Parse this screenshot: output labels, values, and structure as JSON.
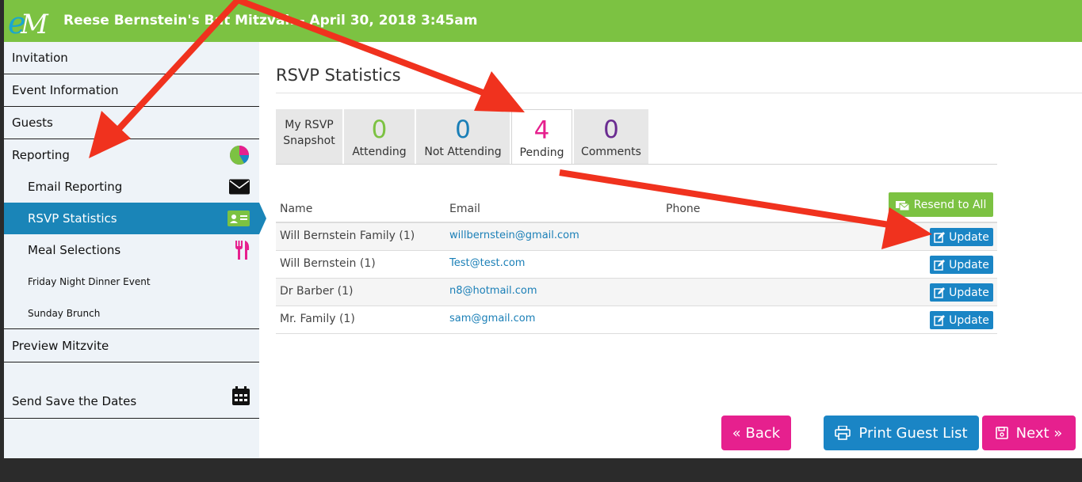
{
  "header": {
    "title": "Reese Bernstein's Bat Mitzvah - April 30, 2018 3:45am",
    "logo_text": "eM",
    "colors": {
      "bar": "#7cc242"
    }
  },
  "sidebar": {
    "items": [
      {
        "label": "Invitation",
        "icon": ""
      },
      {
        "label": "Event Information",
        "icon": ""
      },
      {
        "label": "Guests",
        "icon": ""
      },
      {
        "label": "Reporting",
        "icon": "pie-chart-icon"
      },
      {
        "label": "Email Reporting",
        "icon": "envelope-icon"
      },
      {
        "label": "RSVP Statistics",
        "icon": "id-card-icon",
        "active": true
      },
      {
        "label": "Meal Selections",
        "icon": "utensils-icon"
      },
      {
        "label": "Friday Night Dinner Event",
        "icon": ""
      },
      {
        "label": "Sunday Brunch",
        "icon": ""
      },
      {
        "label": "Preview Mitzvite",
        "icon": ""
      },
      {
        "label": "Send Save the Dates",
        "icon": "calendar-icon"
      }
    ],
    "colors": {
      "active": "#1a85b8"
    }
  },
  "main": {
    "title": "RSVP Statistics",
    "tabs": [
      {
        "label": "My RSVP Snapshot",
        "line1": "My RSVP",
        "line2": "Snapshot"
      },
      {
        "count": "0",
        "label": "Attending",
        "color": "#7cc242"
      },
      {
        "count": "0",
        "label": "Not Attending",
        "color": "#1a7fb7"
      },
      {
        "count": "4",
        "label": "Pending",
        "color": "#e6208e",
        "active": true
      },
      {
        "count": "0",
        "label": "Comments",
        "color": "#6a2c91"
      }
    ],
    "resend_label": "Resend to All",
    "table": {
      "headers": [
        "Name",
        "Email",
        "Phone"
      ],
      "rows": [
        {
          "name": "Will Bernstein Family (1)",
          "email": "willbernstein@gmail.com",
          "phone": "",
          "action": "Update"
        },
        {
          "name": "Will Bernstein (1)",
          "email": "Test@test.com",
          "phone": "",
          "action": "Update"
        },
        {
          "name": "Dr Barber (1)",
          "email": "n8@hotmail.com",
          "phone": "",
          "action": "Update"
        },
        {
          "name": "Mr. Family (1)",
          "email": "sam@gmail.com",
          "phone": "",
          "action": "Update"
        }
      ]
    }
  },
  "footer": {
    "back_label": "« Back",
    "print_label": "Print Guest List",
    "next_label": "Next »"
  },
  "annotation_color": "#f0321e"
}
